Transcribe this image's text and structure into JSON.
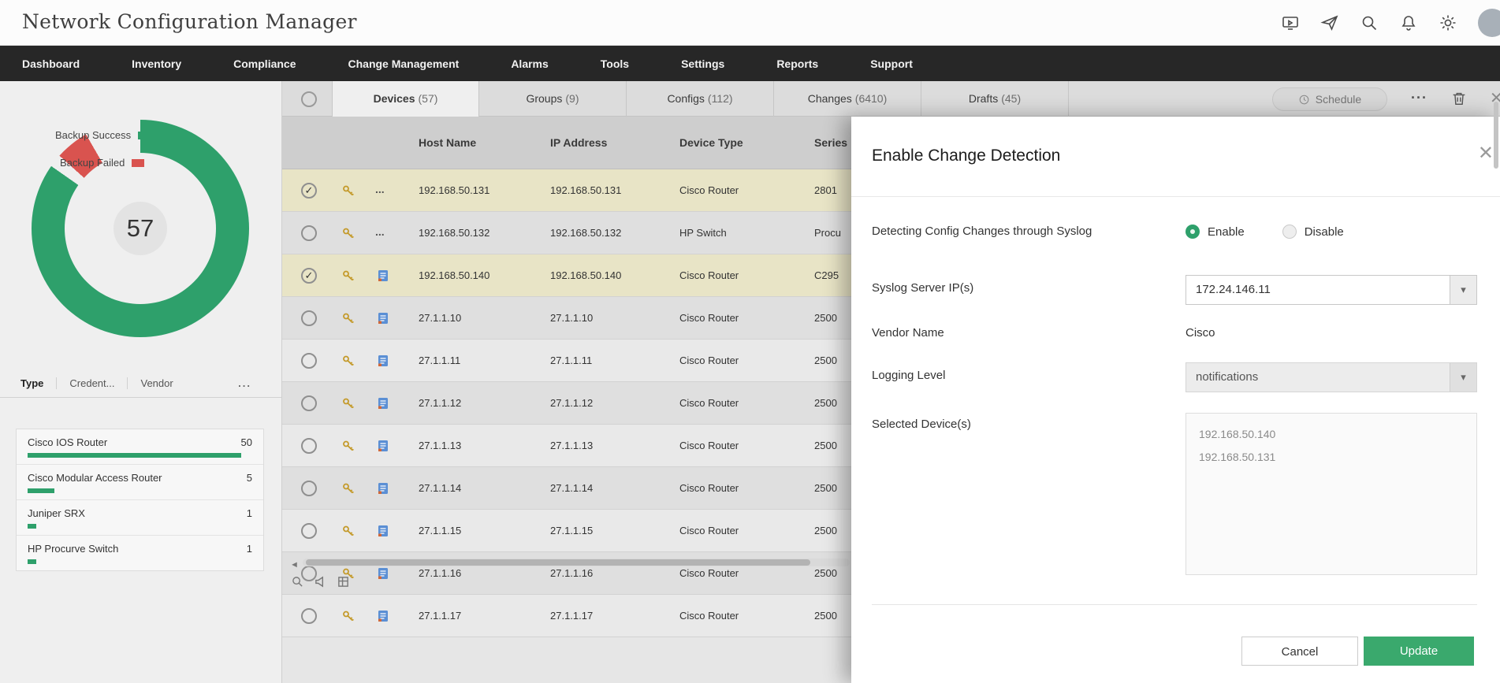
{
  "header": {
    "title": "Network Configuration Manager"
  },
  "nav": {
    "items": [
      "Dashboard",
      "Inventory",
      "Compliance",
      "Change Management",
      "Alarms",
      "Tools",
      "Settings",
      "Reports",
      "Support"
    ]
  },
  "sidebar": {
    "backup_chart": {
      "total": "57",
      "legend_success": "Backup Success",
      "legend_failed": "Backup Failed"
    },
    "tabs": {
      "type": "Type",
      "credential": "Credent...",
      "vendor": "Vendor"
    },
    "device_types": [
      {
        "name": "Cisco IOS Router",
        "count": "50",
        "bar_pct": 95
      },
      {
        "name": "Cisco Modular Access Router",
        "count": "5",
        "bar_pct": 12
      },
      {
        "name": "Juniper SRX",
        "count": "1",
        "bar_pct": 4
      },
      {
        "name": "HP Procurve Switch",
        "count": "1",
        "bar_pct": 4
      }
    ]
  },
  "main": {
    "tabs": [
      {
        "name": "Devices",
        "count": "(57)"
      },
      {
        "name": "Groups",
        "count": "(9)"
      },
      {
        "name": "Configs",
        "count": "(112)"
      },
      {
        "name": "Changes",
        "count": "(6410)"
      },
      {
        "name": "Drafts",
        "count": "(45)"
      }
    ],
    "toolbar": {
      "schedule": "Schedule"
    },
    "table": {
      "columns": {
        "host": "Host Name",
        "ip": "IP Address",
        "type": "Device Type",
        "series": "Series"
      },
      "rows": [
        {
          "host": "192.168.50.131",
          "ip": "192.168.50.131",
          "type": "Cisco Router",
          "series": "2801",
          "checked": true,
          "selected": true,
          "truncated": true
        },
        {
          "host": "192.168.50.132",
          "ip": "192.168.50.132",
          "type": "HP Switch",
          "series": "Procu",
          "checked": false,
          "selected": false,
          "truncated": true
        },
        {
          "host": "192.168.50.140",
          "ip": "192.168.50.140",
          "type": "Cisco Router",
          "series": "C295",
          "checked": true,
          "selected": true,
          "truncated": false
        },
        {
          "host": "27.1.1.10",
          "ip": "27.1.1.10",
          "type": "Cisco Router",
          "series": "2500",
          "checked": false,
          "selected": false,
          "truncated": false
        },
        {
          "host": "27.1.1.11",
          "ip": "27.1.1.11",
          "type": "Cisco Router",
          "series": "2500",
          "checked": false,
          "selected": false,
          "truncated": false
        },
        {
          "host": "27.1.1.12",
          "ip": "27.1.1.12",
          "type": "Cisco Router",
          "series": "2500",
          "checked": false,
          "selected": false,
          "truncated": false
        },
        {
          "host": "27.1.1.13",
          "ip": "27.1.1.13",
          "type": "Cisco Router",
          "series": "2500",
          "checked": false,
          "selected": false,
          "truncated": false
        },
        {
          "host": "27.1.1.14",
          "ip": "27.1.1.14",
          "type": "Cisco Router",
          "series": "2500",
          "checked": false,
          "selected": false,
          "truncated": false
        },
        {
          "host": "27.1.1.15",
          "ip": "27.1.1.15",
          "type": "Cisco Router",
          "series": "2500",
          "checked": false,
          "selected": false,
          "truncated": false
        },
        {
          "host": "27.1.1.16",
          "ip": "27.1.1.16",
          "type": "Cisco Router",
          "series": "2500",
          "checked": false,
          "selected": false,
          "truncated": false
        },
        {
          "host": "27.1.1.17",
          "ip": "27.1.1.17",
          "type": "Cisco Router",
          "series": "2500",
          "checked": false,
          "selected": false,
          "truncated": false
        }
      ]
    }
  },
  "panel": {
    "title": "Enable Change Detection",
    "fields": {
      "syslog_toggle": {
        "label": "Detecting Config Changes through Syslog",
        "enable": "Enable",
        "disable": "Disable",
        "value": "Enable"
      },
      "syslog_server": {
        "label": "Syslog Server IP(s)",
        "value": "172.24.146.11"
      },
      "vendor": {
        "label": "Vendor Name",
        "value": "Cisco"
      },
      "logging_level": {
        "label": "Logging Level",
        "value": "notifications"
      },
      "selected_devices": {
        "label": "Selected Device(s)",
        "values": [
          "192.168.50.140",
          "192.168.50.131"
        ]
      }
    },
    "buttons": {
      "cancel": "Cancel",
      "update": "Update"
    }
  },
  "misc": {
    "ellipsis": "...",
    "close": "✕",
    "back_arrow": "◄",
    "dropdown_arrow": "▾"
  },
  "colors": {
    "accent_green": "#2ea06b",
    "failed_red": "#d9534f",
    "selected_row": "#e8e4c6",
    "nav_dark": "#272727"
  }
}
